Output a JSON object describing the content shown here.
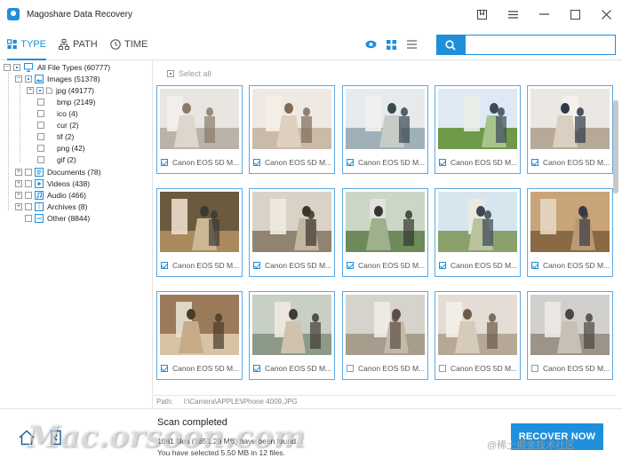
{
  "app": {
    "title": "Magoshare Data Recovery"
  },
  "tabs": [
    {
      "label": "TYPE",
      "active": true
    },
    {
      "label": "PATH",
      "active": false
    },
    {
      "label": "TIME",
      "active": false
    }
  ],
  "search": {
    "placeholder": "",
    "value": ""
  },
  "tree": {
    "root": "All File Types (60777)",
    "images": "Images (51378)",
    "image_types": [
      {
        "label": "jpg (49177)",
        "state": "partial",
        "expandable": true
      },
      {
        "label": "bmp (2149)",
        "state": "unchecked"
      },
      {
        "label": "ico (4)",
        "state": "unchecked"
      },
      {
        "label": "cur (2)",
        "state": "unchecked"
      },
      {
        "label": "tif (2)",
        "state": "unchecked"
      },
      {
        "label": "png (42)",
        "state": "unchecked"
      },
      {
        "label": "gif (2)",
        "state": "unchecked"
      }
    ],
    "categories": [
      {
        "label": "Documents (78)"
      },
      {
        "label": "Videos (438)"
      },
      {
        "label": "Audio (466)"
      },
      {
        "label": "Archives (8)"
      },
      {
        "label": "Other (8844)"
      }
    ]
  },
  "select_all": "Select all",
  "thumbnails": [
    {
      "label": "Canon EOS 5D M...",
      "checked": true
    },
    {
      "label": "Canon EOS 5D M...",
      "checked": true
    },
    {
      "label": "Canon EOS 5D M...",
      "checked": true
    },
    {
      "label": "Canon EOS 5D M...",
      "checked": true
    },
    {
      "label": "Canon EOS 5D M...",
      "checked": true
    },
    {
      "label": "Canon EOS 5D M...",
      "checked": true
    },
    {
      "label": "Canon EOS 5D M...",
      "checked": true
    },
    {
      "label": "Canon EOS 5D M...",
      "checked": true
    },
    {
      "label": "Canon EOS 5D M...",
      "checked": true
    },
    {
      "label": "Canon EOS 5D M...",
      "checked": true
    },
    {
      "label": "Canon EOS 5D M...",
      "checked": true
    },
    {
      "label": "Canon EOS 5D M...",
      "checked": true
    },
    {
      "label": "Canon EOS 5D M...",
      "checked": false
    },
    {
      "label": "Canon EOS 5D M...",
      "checked": false
    },
    {
      "label": "Canon EOS 5D M...",
      "checked": false
    }
  ],
  "path": {
    "label": "Path:",
    "value": "I:\\Camera\\APPLE\\iPhone 4009.JPG"
  },
  "status": {
    "title": "Scan completed",
    "line1": "1961 files (5651.29 MB) have been found.",
    "line2": "You have selected 5.50 MB in 12 files."
  },
  "recover_label": "RECOVER NOW",
  "watermark": {
    "main": "Mac.orsoon.com",
    "secondary": "@稀土掘金技术社区"
  },
  "colors": {
    "accent": "#1e8fdb",
    "card_border": "#5aa9e6"
  }
}
